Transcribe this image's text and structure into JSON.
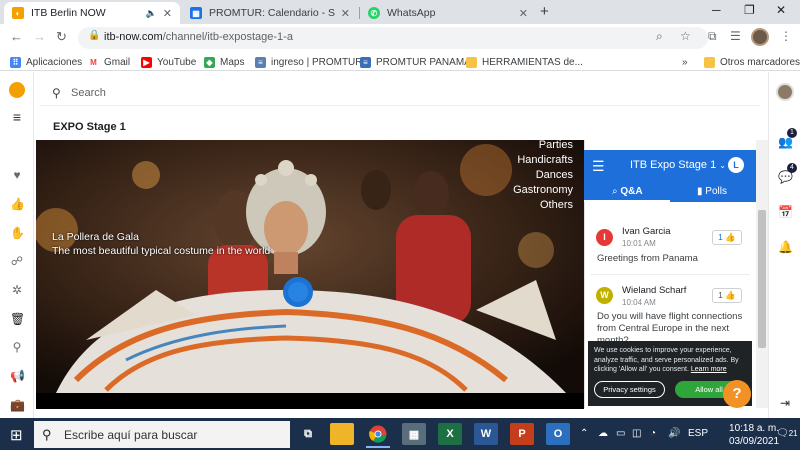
{
  "browser": {
    "tabs": [
      {
        "title": "ITB Berlin NOW",
        "favicon": "itb-favicon",
        "active": true
      },
      {
        "title": "PROMTUR: Calendario - Semana",
        "favicon": "calendar-favicon",
        "active": false
      },
      {
        "title": "WhatsApp",
        "favicon": "whatsapp-favicon",
        "active": false
      }
    ],
    "url_host": "itb-now.com",
    "url_path": "/channel/itb-expostage-1-a",
    "bookmarks": [
      "Aplicaciones",
      "Gmail",
      "YouTube",
      "Maps",
      "ingreso | PROMTUR",
      "PROMTUR PANAMA",
      "HERRAMIENTAS de...",
      "Otros marcadores"
    ],
    "bookmarks_more": "»"
  },
  "page": {
    "search_placeholder": "Search",
    "stage_title": "EXPO Stage 1",
    "video": {
      "categories": [
        "Parties",
        "Handicrafts",
        "Dances",
        "Gastronomy",
        "Others"
      ],
      "caption_title": "La Pollera de Gala",
      "caption_subtitle": "The most beautiful typical costume in the world"
    },
    "chat": {
      "title": "ITB Expo Stage 1",
      "user_initial": "L",
      "tabs": [
        "Q&A",
        "Polls"
      ],
      "messages": [
        {
          "initial": "I",
          "name": "Ivan Garcia",
          "time": "10:01 AM",
          "likes": "1",
          "text": "Greetings from Panama",
          "color": "#e53935"
        },
        {
          "initial": "W",
          "name": "Wieland Scharf",
          "time": "10:04 AM",
          "likes": "1",
          "text": "Do you will have flight connections from Central Europe in the next month?",
          "color": "#c0b000"
        }
      ]
    },
    "cookie": {
      "text": "We use cookies to improve your experience, analyze traffic, and serve personalized ads. By clicking 'Allow all' you consent.",
      "link": "Learn more",
      "settings_label": "Privacy settings",
      "allow_label": "Allow all"
    },
    "help_label": "?",
    "right_rail_badges": [
      "1",
      "4"
    ]
  },
  "taskbar": {
    "search_placeholder": "Escribe aquí para buscar",
    "language": "ESP",
    "time": "10:18 a. m.",
    "date": "03/09/2021",
    "notification_count": "21"
  },
  "colors": {
    "chat_header": "#1e6fd9",
    "allow_button": "#2fa63a",
    "help_button": "#f29124",
    "taskbar": "#1c2f4a"
  }
}
